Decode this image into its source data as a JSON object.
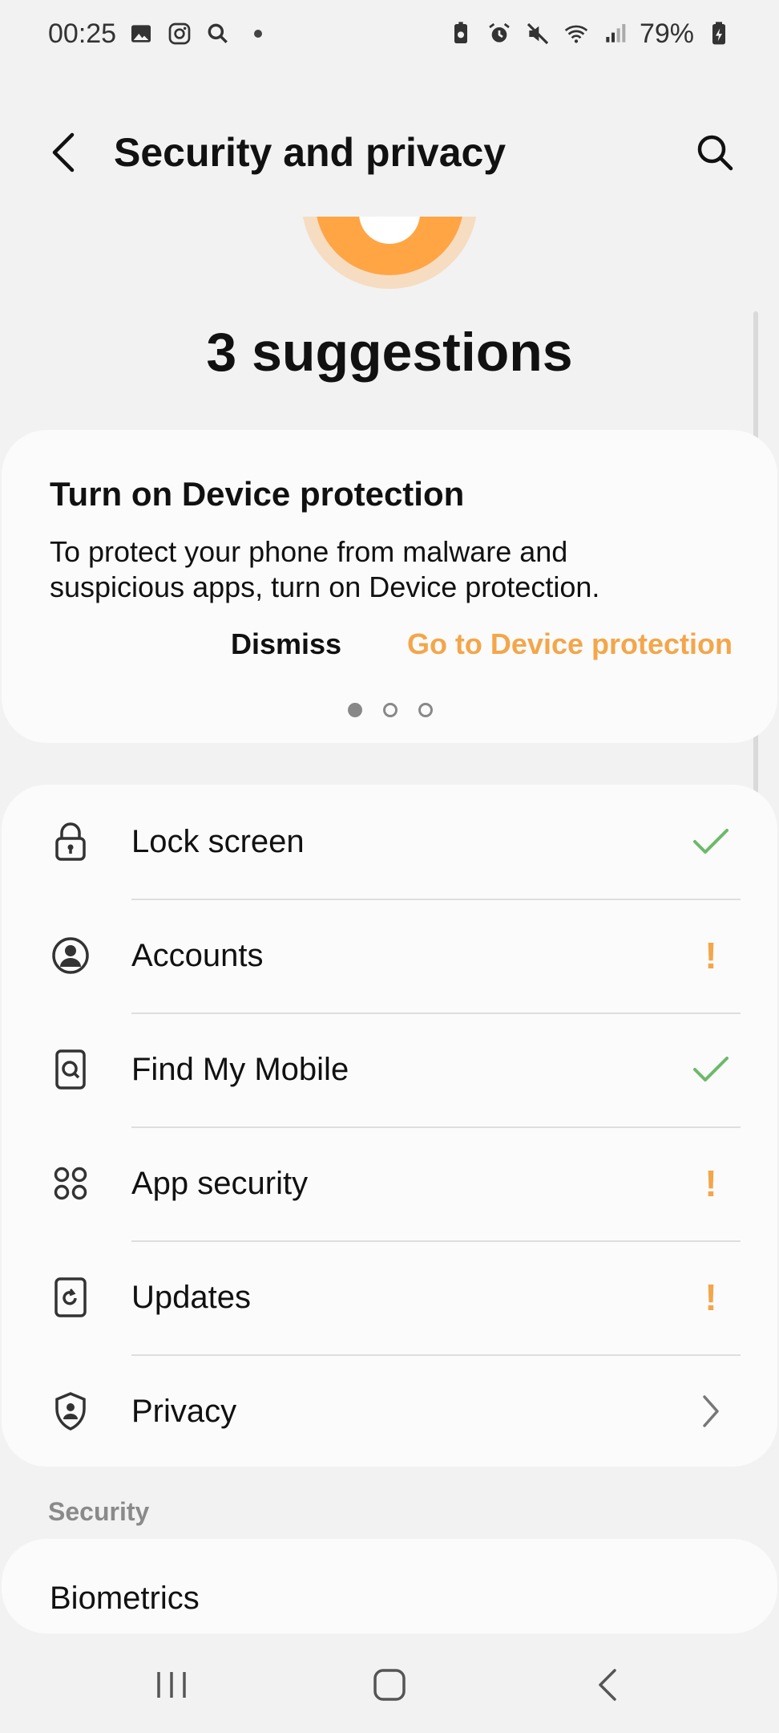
{
  "status_bar": {
    "time": "00:25",
    "battery": "79%",
    "left_icons": [
      "gallery-icon",
      "instagram-icon",
      "search-icon",
      "notification-dot"
    ],
    "right_icons": [
      "battery-saver-icon",
      "alarm-icon",
      "mute-icon",
      "wifi-icon",
      "signal-icon",
      "battery-icon"
    ]
  },
  "header": {
    "title": "Security and privacy"
  },
  "summary": {
    "title": "3 suggestions"
  },
  "suggestion": {
    "title": "Turn on Device protection",
    "body": "To protect your phone from malware and suspicious apps, turn on Device protection.",
    "dismiss_label": "Dismiss",
    "action_label": "Go to Device protection",
    "page_count": 3,
    "active_page": 1
  },
  "list": {
    "items": [
      {
        "label": "Lock screen",
        "icon": "lock-icon",
        "status": "ok"
      },
      {
        "label": "Accounts",
        "icon": "account-icon",
        "status": "warning"
      },
      {
        "label": "Find My Mobile",
        "icon": "find-mobile-icon",
        "status": "ok"
      },
      {
        "label": "App security",
        "icon": "app-security-icon",
        "status": "warning"
      },
      {
        "label": "Updates",
        "icon": "update-icon",
        "status": "warning"
      },
      {
        "label": "Privacy",
        "icon": "privacy-shield-icon",
        "status": "chevron"
      }
    ]
  },
  "security_section": {
    "label": "Security",
    "first_item": "Biometrics"
  },
  "colors": {
    "accent": "#f3a64a",
    "ok": "#6cba6a",
    "background": "#f2f2f2",
    "card": "#fbfbfb"
  }
}
